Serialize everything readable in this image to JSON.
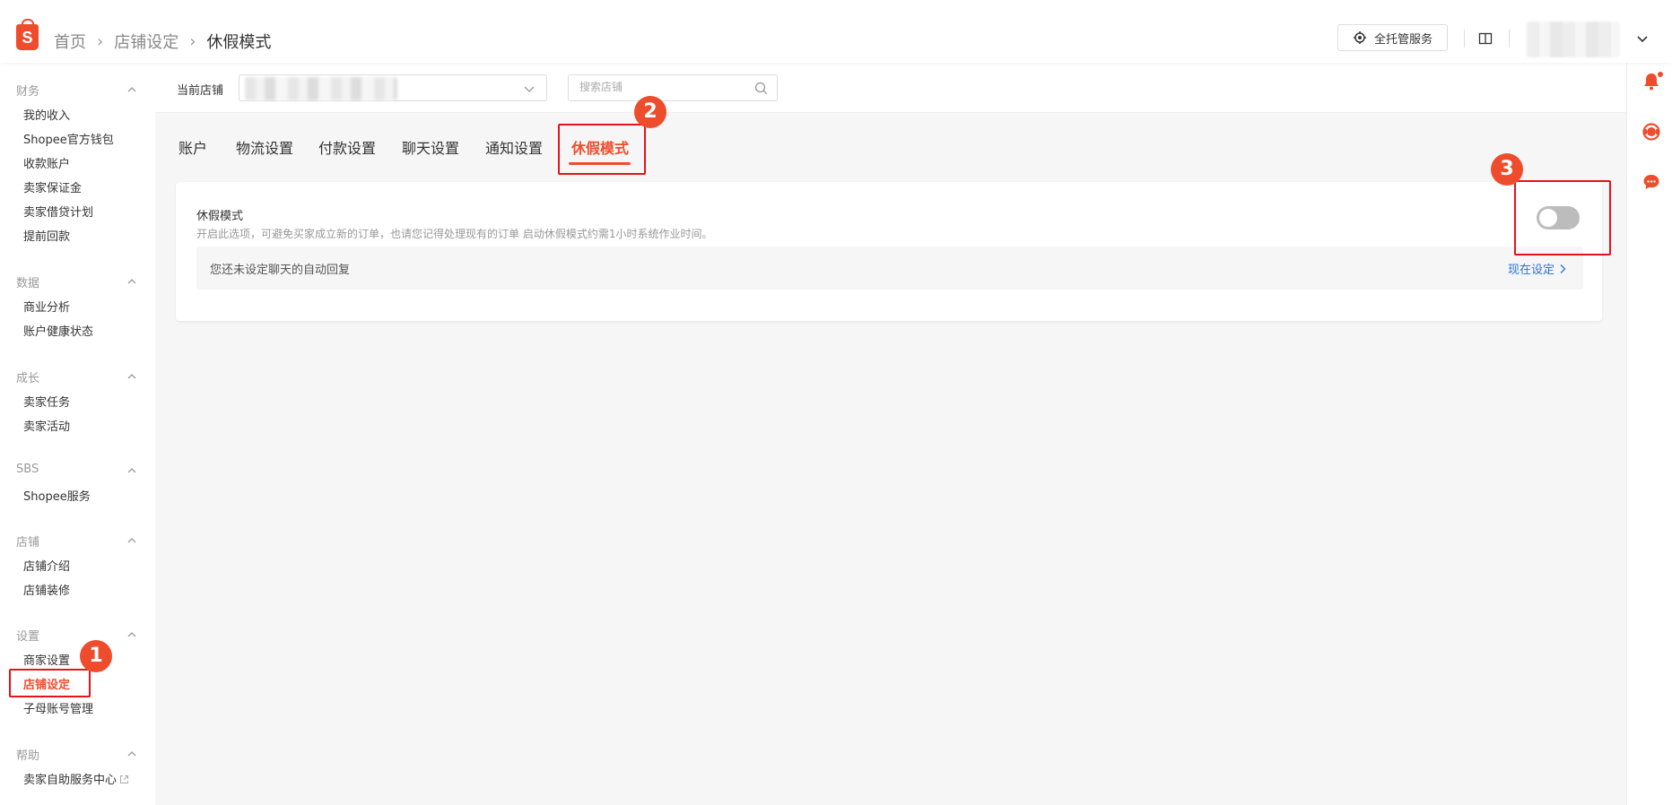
{
  "header": {
    "logo_letter": "S",
    "breadcrumb": [
      "首页",
      "店铺设定",
      "休假模式"
    ],
    "service_button": "全托管服务"
  },
  "sidebar": {
    "groups": [
      {
        "title": "财务",
        "items": [
          "我的收入",
          "Shopee官方钱包",
          "收款账户",
          "卖家保证金",
          "卖家借贷计划",
          "提前回款"
        ]
      },
      {
        "title": "数据",
        "items": [
          "商业分析",
          "账户健康状态"
        ]
      },
      {
        "title": "成长",
        "items": [
          "卖家任务",
          "卖家活动"
        ]
      },
      {
        "title": "SBS",
        "items": [
          "Shopee服务"
        ]
      },
      {
        "title": "店铺",
        "items": [
          "店铺介绍",
          "店铺装修"
        ]
      },
      {
        "title": "设置",
        "items": [
          "商家设置",
          "店铺设定",
          "子母账号管理"
        ]
      },
      {
        "title": "帮助",
        "items": [
          "卖家自助服务中心"
        ]
      }
    ],
    "active_item": "店铺设定"
  },
  "shopbar": {
    "label": "当前店铺",
    "search_placeholder": "搜索店铺"
  },
  "tabs": [
    "账户",
    "物流设置",
    "付款设置",
    "聊天设置",
    "通知设置",
    "休假模式"
  ],
  "active_tab": "休假模式",
  "vacation": {
    "title": "休假模式",
    "description": "开启此选项，可避免买家成立新的订单，也请您记得处理现有的订单 启动休假模式约需1小时系统作业时间。",
    "toggle_on": false,
    "notice_text": "您还未设定聊天的自动回复",
    "notice_link": "现在设定"
  },
  "annotations": {
    "badge_1": "1",
    "badge_2": "2",
    "badge_3": "3",
    "color": "#e8111c"
  },
  "colors": {
    "brand": "#ee4d2d",
    "link": "#2673dd"
  }
}
